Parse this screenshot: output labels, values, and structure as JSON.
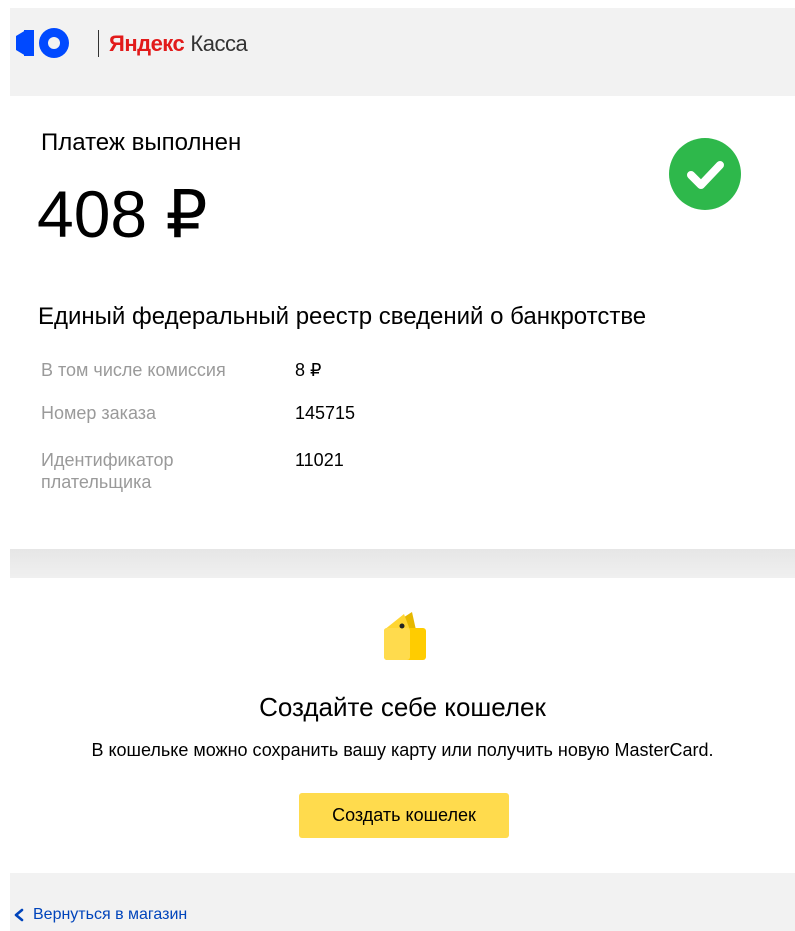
{
  "header": {
    "logo_icon": "yandex-kassa-logo-icon",
    "brand_part1": "Яндекс",
    "brand_part2": "Касса",
    "brand_color": "#e21b1b"
  },
  "receipt": {
    "status_title": "Платеж выполнен",
    "amount": "408 ₽",
    "status_icon": "check-circle-icon",
    "status_color": "#2eb84b",
    "merchant": "Единый федеральный реестр сведений о банкротстве",
    "details": [
      {
        "label": "В том числе комиссия",
        "value": "8 ₽"
      },
      {
        "label": "Номер заказа",
        "value": "145715"
      },
      {
        "label": "Идентификатор плательщика",
        "value": "11021"
      }
    ]
  },
  "wallet_promo": {
    "icon": "wallet-icon",
    "title": "Создайте себе кошелек",
    "description": "В кошельке можно сохранить вашу карту или получить новую MasterCard.",
    "button_label": "Создать кошелек",
    "button_color": "#ffdb4d"
  },
  "footer": {
    "back_icon": "chevron-left-icon",
    "back_label": "Вернуться в магазин",
    "link_color": "#0044bb"
  }
}
